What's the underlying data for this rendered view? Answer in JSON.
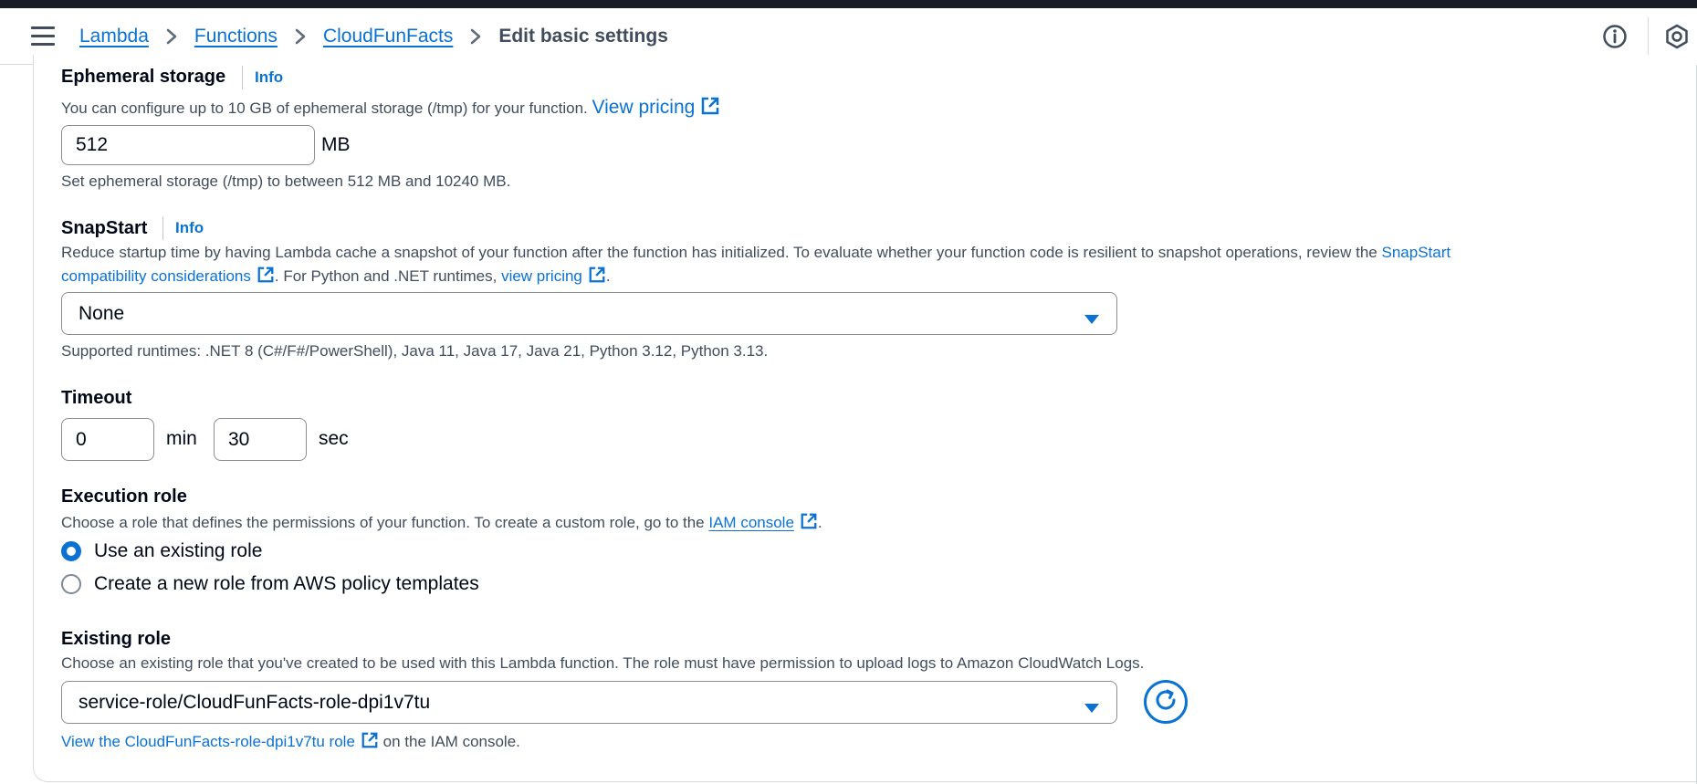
{
  "colors": {
    "accent": "#0972d3",
    "text": "#000716",
    "secondary_text": "#414d5c",
    "border": "#8c8c94",
    "top_strip": "#161d26"
  },
  "navbar": {
    "menu_icon": "hamburger-menu-icon",
    "breadcrumbs": [
      {
        "label": "Lambda",
        "link": true
      },
      {
        "label": "Functions",
        "link": true
      },
      {
        "label": "CloudFunFacts",
        "link": true
      },
      {
        "label": "Edit basic settings",
        "link": false
      }
    ],
    "info_icon": "info-circle-icon",
    "settings_icon": "hexagon-gear-icon"
  },
  "ephemeral": {
    "label": "Ephemeral storage",
    "info": "Info",
    "description": "You can configure up to 10 GB of ephemeral storage (/tmp) for your function.",
    "pricing_link": "View pricing",
    "value": "512",
    "unit": "MB",
    "constraint": "Set ephemeral storage (/tmp) to between 512 MB and 10240 MB."
  },
  "snapstart": {
    "label": "SnapStart",
    "info": "Info",
    "description_1": "Reduce startup time by having Lambda cache a snapshot of your function after the function has initialized. To evaluate whether your function code is resilient to snapshot operations, review the ",
    "link_1a": "SnapStart",
    "link_1b": "compatibility considerations",
    "description_2": ". For Python and .NET runtimes, ",
    "pricing_link": "view pricing",
    "description_3": ".",
    "selected": "None",
    "supported": "Supported runtimes: .NET 8 (C#/F#/PowerShell), Java 11, Java 17, Java 21, Python 3.12, Python 3.13."
  },
  "timeout": {
    "label": "Timeout",
    "min_value": "0",
    "min_unit": "min",
    "sec_value": "30",
    "sec_unit": "sec"
  },
  "execution_role": {
    "label": "Execution role",
    "description": "Choose a role that defines the permissions of your function. To create a custom role, go to the ",
    "iam_link": "IAM console",
    "description_end": ".",
    "options": [
      {
        "label": "Use an existing role",
        "checked": true
      },
      {
        "label": "Create a new role from AWS policy templates",
        "checked": false
      }
    ]
  },
  "existing_role": {
    "label": "Existing role",
    "description": "Choose an existing role that you've created to be used with this Lambda function. The role must have permission to upload logs to Amazon CloudWatch Logs.",
    "selected": "service-role/CloudFunFacts-role-dpi1v7tu",
    "view_link": "View the CloudFunFacts-role-dpi1v7tu role",
    "view_suffix": " on the IAM console."
  }
}
